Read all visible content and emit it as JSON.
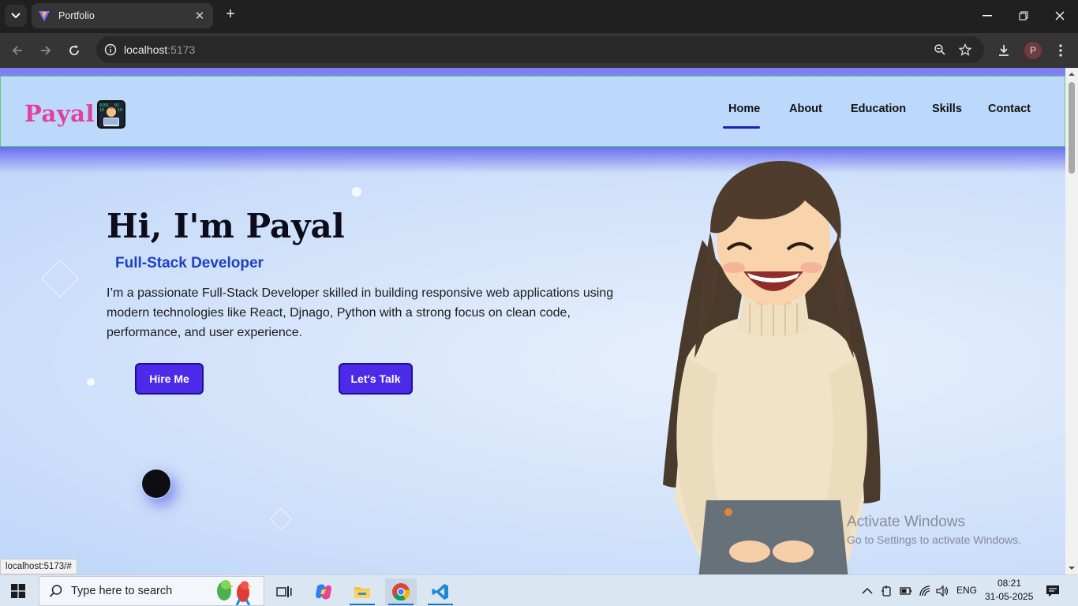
{
  "browser": {
    "tab_title": "Portfolio",
    "new_tab_icon": "plus-icon",
    "url_host": "localhost",
    "url_port": ":5173",
    "profile_initial": "P"
  },
  "site": {
    "brand": "Payal",
    "nav": {
      "home": "Home",
      "about": "About",
      "education": "Education",
      "skills": "Skills",
      "contact": "Contact"
    },
    "hero": {
      "title": "Hi, I'm Payal",
      "subtitle": "Full-Stack Developer",
      "description": "I’m a passionate Full-Stack Developer skilled in building responsive web applications using modern technologies like React, Djnago, Python with a strong focus on clean code, performance, and user experience.",
      "hire_button": "Hire Me",
      "talk_button": "Let's Talk"
    },
    "accent_colors": {
      "brand_pink": "#e43f9a",
      "button_purple": "#4b2ae8",
      "subtitle_blue": "#1f3fbf"
    }
  },
  "status_bar_url": "localhost:5173/#",
  "watermark": {
    "title": "Activate Windows",
    "subtitle": "Go to Settings to activate Windows."
  },
  "taskbar": {
    "search_placeholder": "Type here to search",
    "language": "ENG",
    "time": "08:21",
    "date": "31-05-2025"
  }
}
